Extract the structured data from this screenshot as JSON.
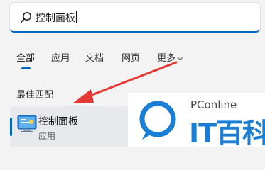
{
  "search": {
    "query": "控制面板"
  },
  "tabs": [
    {
      "label": "全部",
      "active": true
    },
    {
      "label": "应用"
    },
    {
      "label": "文档"
    },
    {
      "label": "网页"
    },
    {
      "label": "更多"
    }
  ],
  "best_match": {
    "title": "最佳匹配",
    "item": {
      "name": "控制面板",
      "type": "应用",
      "icon": "control-panel-icon"
    }
  },
  "watermark": {
    "brand": "PConline",
    "text": "IT百科"
  },
  "colors": {
    "accent": "#0067c0",
    "arrow": "#e53935",
    "watermark": "#1a7fd4"
  }
}
